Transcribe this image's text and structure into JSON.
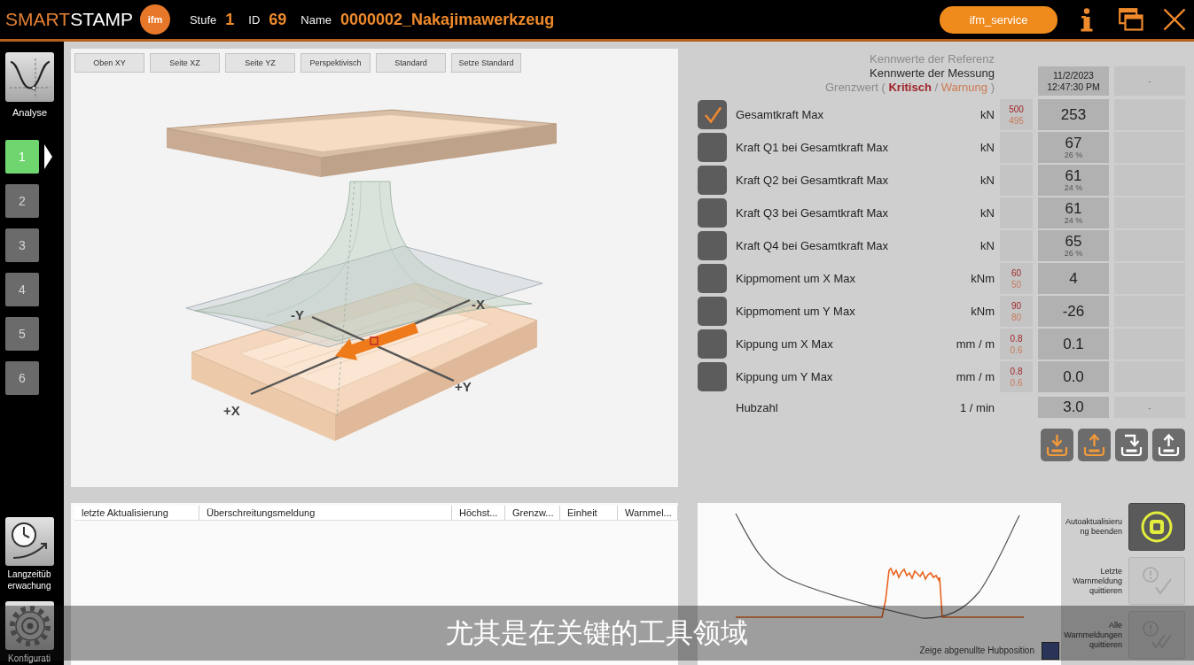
{
  "header": {
    "logo": {
      "part_1": "SMART",
      "part_2": "STAMP",
      "badge": "ifm"
    },
    "fields": [
      {
        "label": "Stufe",
        "value": "1"
      },
      {
        "label": "ID",
        "value": "69"
      },
      {
        "label": "Name",
        "value": "0000002_Nakajimawerkzeug"
      }
    ],
    "service_button": "ifm_service"
  },
  "sidebar": {
    "analysis_label": "Analyse",
    "steps": [
      {
        "label": "1",
        "selected": true
      },
      {
        "label": "2",
        "selected": false
      },
      {
        "label": "3",
        "selected": false
      },
      {
        "label": "4",
        "selected": false
      },
      {
        "label": "5",
        "selected": false
      },
      {
        "label": "6",
        "selected": false
      }
    ],
    "bottom_items": [
      {
        "kind": "clock",
        "label": "Langzeitüberwachung"
      },
      {
        "kind": "gear",
        "label": "Konfigurati"
      }
    ]
  },
  "view_panel": {
    "buttons": [
      "Oben XY",
      "Seite XZ",
      "Seite YZ",
      "Perspektivisch",
      "Standard",
      "Setze Standard"
    ],
    "axis_labels": [
      "-Y",
      "-X",
      "+X",
      "+Y"
    ]
  },
  "values_panel": {
    "legend": {
      "reference": "Kennwerte der Referenz",
      "measurement": "Kennwerte der Messung",
      "limit": {
        "label": "Grenzwert (",
        "critical": "Kritisch",
        "separator": "/",
        "warning": "Warnung",
        "close": ")"
      }
    },
    "measurement_header": {
      "date": "11/2/2023",
      "time": "12:47:30 PM"
    },
    "reference_header": "-",
    "rows": [
      {
        "kind": "check",
        "label": "Gesamtkraft Max",
        "unit": "kN",
        "checked": true,
        "critical": "500",
        "warning": "495",
        "value": "253"
      },
      {
        "kind": "check",
        "label": "Kraft Q1 bei Gesamtkraft Max",
        "unit": "kN",
        "checked": false,
        "value": "67",
        "share": "26 %"
      },
      {
        "kind": "check",
        "label": "Kraft Q2 bei Gesamtkraft Max",
        "unit": "kN",
        "checked": false,
        "value": "61",
        "share": "24 %"
      },
      {
        "kind": "check",
        "label": "Kraft Q3 bei Gesamtkraft Max",
        "unit": "kN",
        "checked": false,
        "value": "61",
        "share": "24 %"
      },
      {
        "kind": "check",
        "label": "Kraft Q4 bei Gesamtkraft Max",
        "unit": "kN",
        "checked": false,
        "value": "65",
        "share": "26 %"
      },
      {
        "kind": "check",
        "label": "Kippmoment um X Max",
        "unit": "kNm",
        "checked": false,
        "critical": "60",
        "warning": "50",
        "value": "4"
      },
      {
        "kind": "check",
        "label": "Kippmoment um Y Max",
        "unit": "kNm",
        "checked": false,
        "critical": "90",
        "warning": "80",
        "value": "-26"
      },
      {
        "kind": "check",
        "label": "Kippung um X Max",
        "unit": "mm / m",
        "checked": false,
        "critical": "0.8",
        "warning": "0.6",
        "value": "0.1"
      },
      {
        "kind": "check",
        "label": "Kippung um Y Max",
        "unit": "mm / m",
        "checked": false,
        "critical": "0.8",
        "warning": "0.6",
        "value": "0.0"
      },
      {
        "kind": "plain",
        "label": "Hubzahl",
        "unit": "1 / min",
        "value": "3.0",
        "reference": "-"
      }
    ],
    "actions": [
      {
        "kind": "down",
        "accent": true
      },
      {
        "kind": "up",
        "accent": true
      },
      {
        "kind": "turn-down",
        "accent": false
      },
      {
        "kind": "up",
        "accent": false
      }
    ]
  },
  "message_table": {
    "columns": [
      "letzte Aktualisierung",
      "Überschreitungsmeldung",
      "Höchst...",
      "Grenzw...",
      "Einheit",
      "Warnmel..."
    ]
  },
  "trace_panel": {
    "checkbox_label": "Zeige abgenullte Hubposition",
    "checked": false
  },
  "commands": [
    {
      "kind": "stop",
      "label": "Autoaktualisierung beenden",
      "disabled": false
    },
    {
      "kind": "ack",
      "label": "Letzte Warnmeldung quittieren",
      "disabled": true
    },
    {
      "kind": "ack-all",
      "label": "Alle Warnmeldungen quittieren",
      "disabled": true
    }
  ],
  "subtitle": "尤其是在关键的工具领域"
}
